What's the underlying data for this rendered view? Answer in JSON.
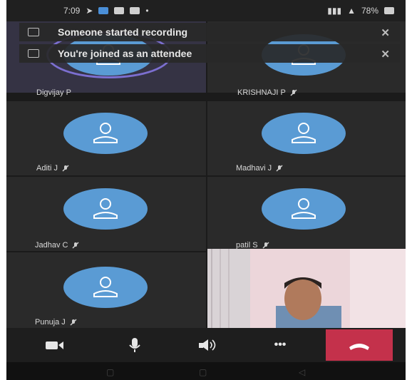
{
  "status_bar": {
    "time": "7:09",
    "right_text": "78%"
  },
  "notifications": [
    {
      "text": "Someone started recording",
      "close": "✕"
    },
    {
      "text": "You're joined as an attendee",
      "close": "✕"
    }
  ],
  "participants": [
    {
      "name": "Digvijay P"
    },
    {
      "name": "KRISHNAJI P"
    },
    {
      "name": "Aditi J"
    },
    {
      "name": "Madhavi J"
    },
    {
      "name": "Jadhav C"
    },
    {
      "name": "patil S"
    },
    {
      "name": "Punuja J"
    }
  ],
  "controls": {
    "more_label": "•••"
  },
  "colors": {
    "avatar": "#5a9bd4",
    "end_call": "#c4314b",
    "speaker_ring": "#7c6fd0"
  }
}
